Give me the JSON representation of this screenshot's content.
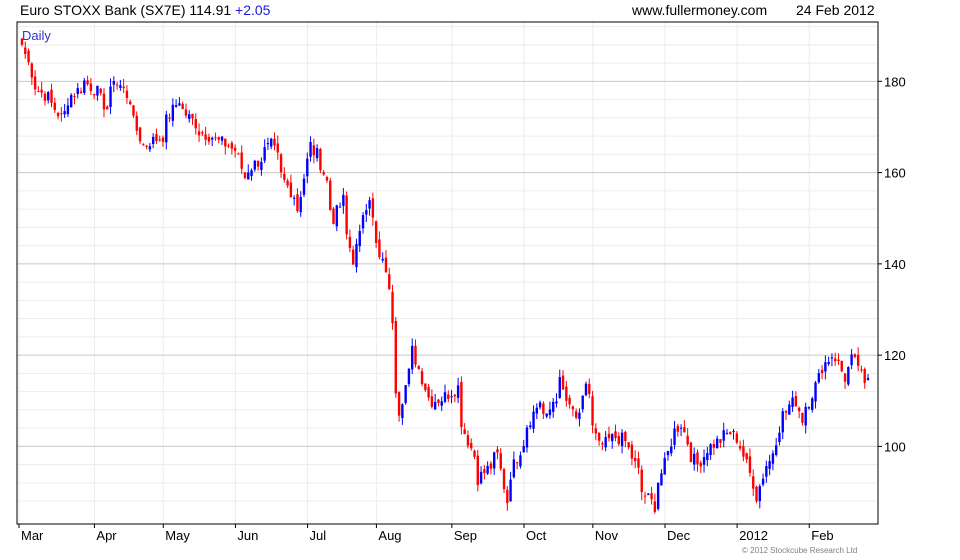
{
  "header": {
    "instrument": "Euro STOXX Bank (SX7E)",
    "last": "114.91",
    "change": "+2.05",
    "site": "www.fullermoney.com",
    "date": "24 Feb 2012"
  },
  "copyright": "© 2012 Stockcube Research Ltd",
  "colors": {
    "up": "#0000ff",
    "down": "#ff0000",
    "grid": "#c8c8c8",
    "minor_grid": "#ececec",
    "label": "#3333cc"
  },
  "chart_data": {
    "type": "candlestick",
    "interval_label": "Daily",
    "y_axis": {
      "position": "right",
      "ticks": [
        100,
        120,
        140,
        160,
        180
      ],
      "ylim": [
        83,
        193
      ]
    },
    "x_axis": {
      "ticks": [
        "Mar",
        "Apr",
        "May",
        "Jun",
        "Jul",
        "Aug",
        "Sep",
        "Oct",
        "Nov",
        "Dec",
        "2012",
        "Feb"
      ]
    },
    "grid": true,
    "up_color": "blue",
    "down_color": "red",
    "close_anchors": [
      [
        "2011-03-01",
        188
      ],
      [
        "2011-03-04",
        182
      ],
      [
        "2011-03-08",
        178
      ],
      [
        "2011-03-14",
        175
      ],
      [
        "2011-03-17",
        172
      ],
      [
        "2011-03-22",
        177
      ],
      [
        "2011-03-28",
        180
      ],
      [
        "2011-04-04",
        176
      ],
      [
        "2011-04-06",
        174
      ],
      [
        "2011-04-08",
        181
      ],
      [
        "2011-04-12",
        179
      ],
      [
        "2011-04-15",
        176
      ],
      [
        "2011-04-21",
        166
      ],
      [
        "2011-04-26",
        167
      ],
      [
        "2011-04-29",
        168
      ],
      [
        "2011-05-06",
        176
      ],
      [
        "2011-05-11",
        172
      ],
      [
        "2011-05-16",
        169
      ],
      [
        "2011-05-23",
        167
      ],
      [
        "2011-05-31",
        165
      ],
      [
        "2011-06-03",
        159
      ],
      [
        "2011-06-10",
        163
      ],
      [
        "2011-06-15",
        166
      ],
      [
        "2011-06-21",
        158
      ],
      [
        "2011-06-27",
        152
      ],
      [
        "2011-07-01",
        166
      ],
      [
        "2011-07-05",
        164
      ],
      [
        "2011-07-08",
        158
      ],
      [
        "2011-07-12",
        150
      ],
      [
        "2011-07-15",
        154
      ],
      [
        "2011-07-20",
        141
      ],
      [
        "2011-07-22",
        146
      ],
      [
        "2011-07-27",
        155
      ],
      [
        "2011-07-29",
        144
      ],
      [
        "2011-08-03",
        139
      ],
      [
        "2011-08-05",
        128
      ],
      [
        "2011-08-09",
        108
      ],
      [
        "2011-08-12",
        116
      ],
      [
        "2011-08-15",
        121
      ],
      [
        "2011-08-19",
        113
      ],
      [
        "2011-08-23",
        110
      ],
      [
        "2011-08-29",
        111
      ],
      [
        "2011-09-02",
        113
      ],
      [
        "2011-09-06",
        103
      ],
      [
        "2011-09-12",
        93
      ],
      [
        "2011-09-15",
        95
      ],
      [
        "2011-09-20",
        98
      ],
      [
        "2011-09-23",
        88
      ],
      [
        "2011-09-27",
        96
      ],
      [
        "2011-09-30",
        101
      ],
      [
        "2011-10-04",
        106
      ],
      [
        "2011-10-07",
        110
      ],
      [
        "2011-10-11",
        106
      ],
      [
        "2011-10-13",
        110
      ],
      [
        "2011-10-17",
        114
      ],
      [
        "2011-10-20",
        108
      ],
      [
        "2011-10-25",
        106
      ],
      [
        "2011-10-27",
        114
      ],
      [
        "2011-10-31",
        104
      ],
      [
        "2011-11-02",
        100
      ],
      [
        "2011-11-09",
        102
      ],
      [
        "2011-11-14",
        101
      ],
      [
        "2011-11-17",
        96
      ],
      [
        "2011-11-21",
        90
      ],
      [
        "2011-11-25",
        87
      ],
      [
        "2011-11-30",
        96
      ],
      [
        "2011-12-02",
        101
      ],
      [
        "2011-12-07",
        105
      ],
      [
        "2011-12-09",
        101
      ],
      [
        "2011-12-14",
        96
      ],
      [
        "2011-12-16",
        98
      ],
      [
        "2011-12-22",
        101
      ],
      [
        "2011-12-28",
        103
      ],
      [
        "2012-01-02",
        100
      ],
      [
        "2012-01-06",
        92
      ],
      [
        "2012-01-09",
        89
      ],
      [
        "2012-01-12",
        96
      ],
      [
        "2012-01-16",
        99
      ],
      [
        "2012-01-19",
        107
      ],
      [
        "2012-01-25",
        110
      ],
      [
        "2012-01-27",
        106
      ],
      [
        "2012-01-31",
        110
      ],
      [
        "2012-02-03",
        115
      ],
      [
        "2012-02-09",
        120
      ],
      [
        "2012-02-13",
        118
      ],
      [
        "2012-02-15",
        115
      ],
      [
        "2012-02-17",
        119
      ],
      [
        "2012-02-21",
        118
      ],
      [
        "2012-02-23",
        113
      ],
      [
        "2012-02-24",
        115
      ]
    ]
  }
}
